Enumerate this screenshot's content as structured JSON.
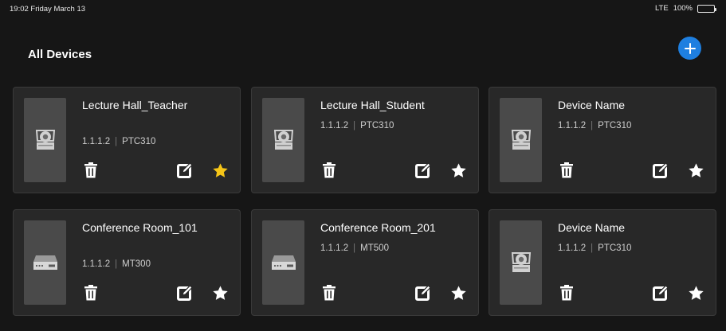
{
  "status_bar": {
    "time_date": "19:02  Friday March 13",
    "network": "LTE",
    "battery": "100%",
    "battery_level": 1.0
  },
  "header": {
    "title": "All Devices",
    "add_icon": "plus-icon"
  },
  "colors": {
    "accent": "#1e7fe0",
    "favorite_active": "#f5c518",
    "favorite_inactive": "#ffffff",
    "card_bg": "#282828",
    "page_bg": "#161616"
  },
  "devices": [
    {
      "name": "Lecture Hall_Teacher",
      "ip": "1.1.1.2",
      "model": "PTC310",
      "type": "camera",
      "icon": "ptz-camera-icon",
      "favorite": true
    },
    {
      "name": "Lecture Hall_Student",
      "ip": "1.1.1.2",
      "model": "PTC310",
      "type": "camera",
      "icon": "ptz-camera-icon",
      "favorite": false
    },
    {
      "name": "Device Name",
      "ip": "1.1.1.2",
      "model": "PTC310",
      "type": "camera",
      "icon": "ptz-camera-icon",
      "favorite": false
    },
    {
      "name": "Conference Room_101",
      "ip": "1.1.1.2",
      "model": "MT300",
      "type": "box",
      "icon": "media-box-icon",
      "favorite": false
    },
    {
      "name": "Conference Room_201",
      "ip": "1.1.1.2",
      "model": "MT500",
      "type": "box",
      "icon": "media-box-icon",
      "favorite": false
    },
    {
      "name": "Device Name",
      "ip": "1.1.1.2",
      "model": "PTC310",
      "type": "camera",
      "icon": "ptz-camera-icon",
      "favorite": false
    }
  ]
}
